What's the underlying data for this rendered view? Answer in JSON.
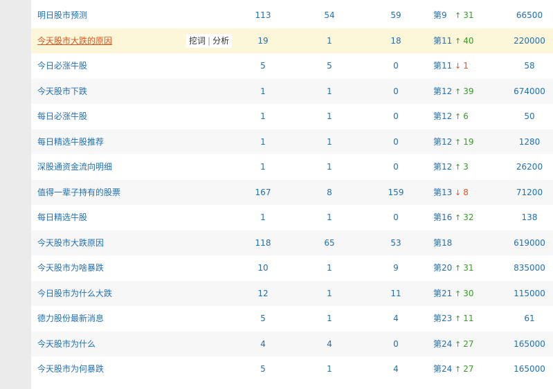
{
  "tools": {
    "dig_label": "挖词",
    "separator": "|",
    "analyze_label": "分析"
  },
  "rows": [
    {
      "keyword": "明日股市预测",
      "a": "113",
      "b": "54",
      "c": "59",
      "rank": "第9",
      "dir": "up",
      "arrow": "↑",
      "change": "31",
      "index": "66500",
      "highlight": false
    },
    {
      "keyword": "今天股市大跌的原因",
      "a": "19",
      "b": "1",
      "c": "18",
      "rank": "第11",
      "dir": "up",
      "arrow": "↑",
      "change": "40",
      "index": "220000",
      "highlight": true
    },
    {
      "keyword": "今日必涨牛股",
      "a": "5",
      "b": "5",
      "c": "0",
      "rank": "第11",
      "dir": "down",
      "arrow": "↓",
      "change": "1",
      "index": "58",
      "highlight": false
    },
    {
      "keyword": "今天股市下跌",
      "a": "1",
      "b": "1",
      "c": "0",
      "rank": "第12",
      "dir": "up",
      "arrow": "↑",
      "change": "39",
      "index": "674000",
      "highlight": false
    },
    {
      "keyword": "每日必涨牛股",
      "a": "1",
      "b": "1",
      "c": "0",
      "rank": "第12",
      "dir": "up",
      "arrow": "↑",
      "change": "6",
      "index": "50",
      "highlight": false
    },
    {
      "keyword": "每日精选牛股推荐",
      "a": "1",
      "b": "1",
      "c": "0",
      "rank": "第12",
      "dir": "up",
      "arrow": "↑",
      "change": "19",
      "index": "1280",
      "highlight": false
    },
    {
      "keyword": "深股通资金流向明细",
      "a": "1",
      "b": "1",
      "c": "0",
      "rank": "第12",
      "dir": "up",
      "arrow": "↑",
      "change": "3",
      "index": "26200",
      "highlight": false
    },
    {
      "keyword": "值得一辈子持有的股票",
      "a": "167",
      "b": "8",
      "c": "159",
      "rank": "第13",
      "dir": "down",
      "arrow": "↓",
      "change": "8",
      "index": "71200",
      "highlight": false
    },
    {
      "keyword": "每日精选牛股",
      "a": "1",
      "b": "1",
      "c": "0",
      "rank": "第16",
      "dir": "up",
      "arrow": "↑",
      "change": "32",
      "index": "138",
      "highlight": false
    },
    {
      "keyword": "今天股市大跌原因",
      "a": "118",
      "b": "65",
      "c": "53",
      "rank": "第18",
      "dir": "none",
      "arrow": "",
      "change": "",
      "index": "619000",
      "highlight": false
    },
    {
      "keyword": "今天股市为啥暴跌",
      "a": "10",
      "b": "1",
      "c": "9",
      "rank": "第20",
      "dir": "up",
      "arrow": "↑",
      "change": "31",
      "index": "835000",
      "highlight": false
    },
    {
      "keyword": "今日股市为什么大跌",
      "a": "12",
      "b": "1",
      "c": "11",
      "rank": "第21",
      "dir": "up",
      "arrow": "↑",
      "change": "30",
      "index": "115000",
      "highlight": false
    },
    {
      "keyword": "德力股份最新消息",
      "a": "5",
      "b": "1",
      "c": "4",
      "rank": "第23",
      "dir": "up",
      "arrow": "↑",
      "change": "11",
      "index": "61",
      "highlight": false
    },
    {
      "keyword": "今天股市为什么",
      "a": "4",
      "b": "4",
      "c": "0",
      "rank": "第24",
      "dir": "up",
      "arrow": "↑",
      "change": "27",
      "index": "165000",
      "highlight": false
    },
    {
      "keyword": "今天股市为何暴跌",
      "a": "5",
      "b": "1",
      "c": "4",
      "rank": "第24",
      "dir": "up",
      "arrow": "↑",
      "change": "27",
      "index": "165000",
      "highlight": false
    }
  ],
  "colors": {
    "link": "#1f6fb5",
    "up": "#3a9a2a",
    "down": "#e0531e",
    "highlight_bg": "#fdf7d9"
  }
}
